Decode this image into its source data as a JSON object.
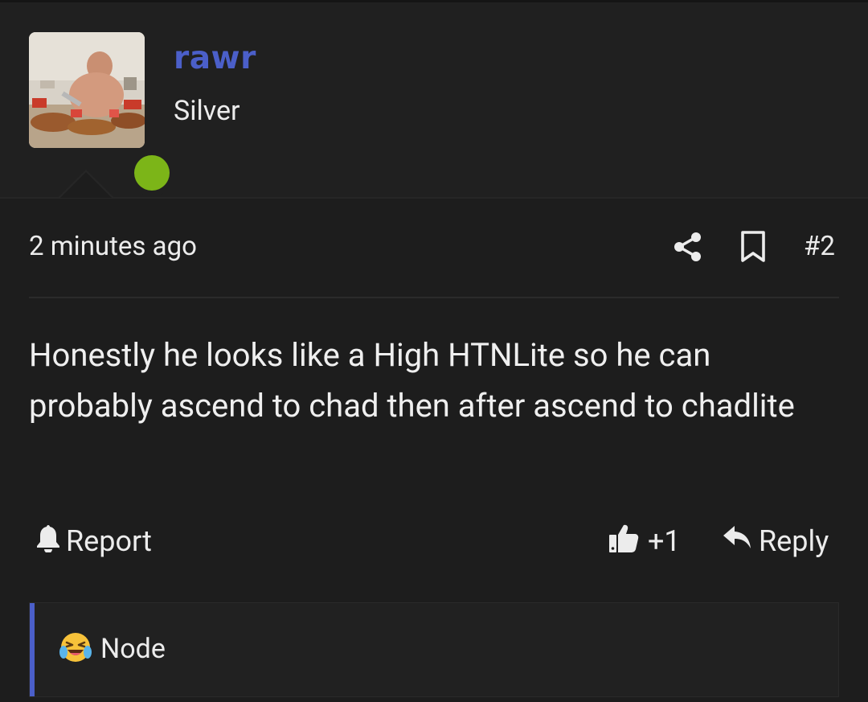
{
  "post": {
    "author": {
      "username": "rawr",
      "rank": "Silver",
      "online": true
    },
    "time": "2 minutes ago",
    "number": "#2",
    "body": "Honestly he looks like a High HTNLite so he can probably ascend to chad then after ascend to chadlite"
  },
  "actions": {
    "report_label": "Report",
    "like_count": "+1",
    "reply_label": "Reply"
  },
  "reactions": {
    "user": "Node",
    "emoji": "laughing-crying-emoji"
  },
  "colors": {
    "username": "#4b5fc9",
    "online_dot": "#7cb518",
    "accent_bar": "#4b5fc9",
    "background": "#1d1d1d"
  }
}
